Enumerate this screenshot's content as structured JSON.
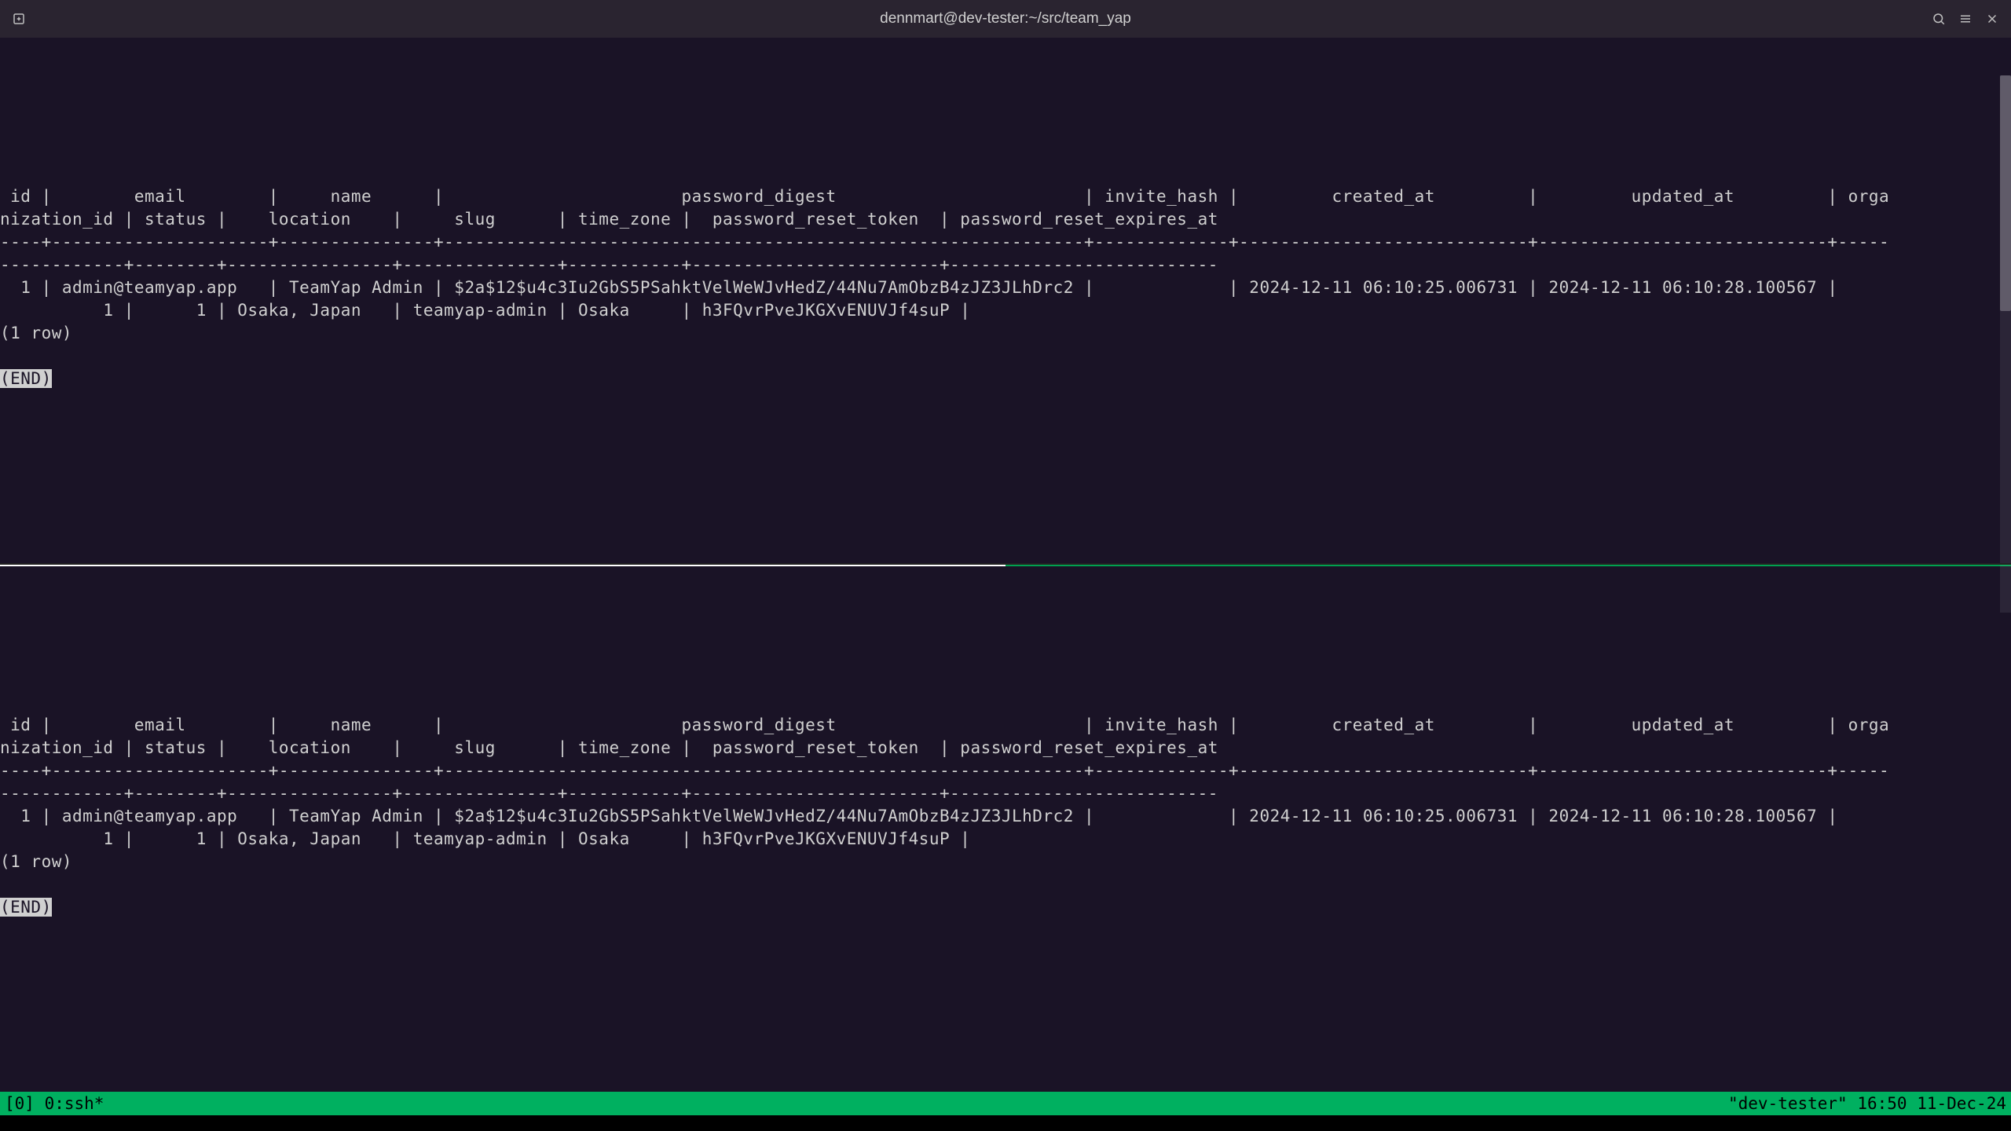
{
  "window": {
    "title": "dennmart@dev-tester:~/src/team_yap"
  },
  "sql": {
    "header1": " id |        email        |     name      |                       password_digest                        | invite_hash |         created_at         |         updated_at         | orga",
    "header2": "nization_id | status |    location    |     slug      | time_zone |  password_reset_token  | password_reset_expires_at",
    "sep1": "----+---------------------+---------------+--------------------------------------------------------------+-------------+----------------------------+----------------------------+-----",
    "sep2": "------------+--------+----------------+---------------+-----------+------------------------+--------------------------",
    "row1": "  1 | admin@teamyap.app   | TeamYap Admin | $2a$12$u4c3Iu2GbS5PSahktVelWeWJvHedZ/44Nu7AmObzB4zJZ3JLhDrc2 |             | 2024-12-11 06:10:25.006731 | 2024-12-11 06:10:28.100567 |",
    "row2": "          1 |      1 | Osaka, Japan   | teamyap-admin | Osaka     | h3FQvrPveJKGXvENUVJf4suP |",
    "count": "(1 row)",
    "end": "(END)"
  },
  "tmux": {
    "left": "[0] 0:ssh*",
    "right": "\"dev-tester\" 16:50 11-Dec-24"
  }
}
